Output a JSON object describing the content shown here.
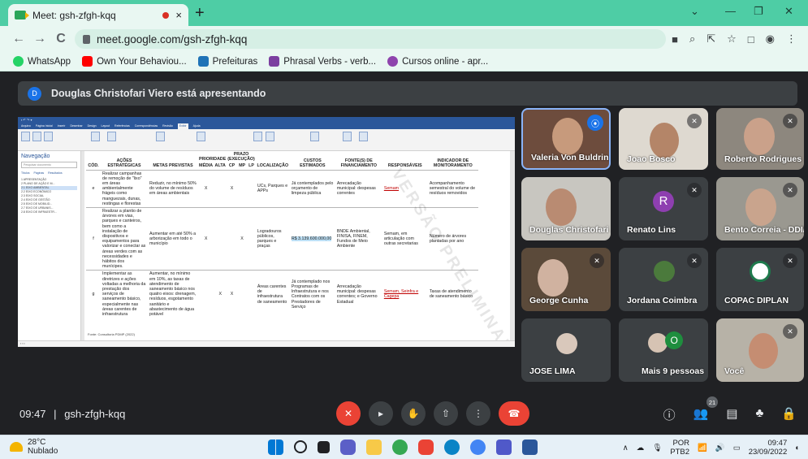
{
  "browser": {
    "tab_title": "Meet: gsh-zfgh-kqq",
    "tab_close": "×",
    "new_tab": "+",
    "url": "meet.google.com/gsh-zfgh-kqq",
    "window_controls": {
      "collapse": "⌄",
      "minimize": "—",
      "restore": "❐",
      "close": "✕"
    },
    "nav": {
      "back": "←",
      "forward": "→",
      "reload": "C"
    },
    "bookmarks": [
      {
        "label": "WhatsApp",
        "icon": "whatsapp-icon",
        "color": "#25d366"
      },
      {
        "label": "Own Your Behaviou...",
        "icon": "youtube-icon",
        "color": "#ff0000"
      },
      {
        "label": "Prefeituras",
        "icon": "prefeituras-icon",
        "color": "#1f73b7"
      },
      {
        "label": "Phrasal Verbs - verb...",
        "icon": "tm-icon",
        "color": "#7b3fa0"
      },
      {
        "label": "Cursos online - apr...",
        "icon": "cursos-icon",
        "color": "#8e44ad"
      }
    ]
  },
  "meet": {
    "presenter_initial": "D",
    "presenter_text": "Douglas Christofari Viero está apresentando",
    "meeting_time": "09:47",
    "meeting_code": "gsh-zfgh-kqq",
    "participant_count": "21",
    "tiles": [
      {
        "name": "Valeria Von Buldring",
        "icon": "speaking-icon"
      },
      {
        "name": "Joao Bosco",
        "icon": "mic-off-icon"
      },
      {
        "name": "Roberto Rodrigues",
        "icon": "mic-off-icon"
      },
      {
        "name": "Douglas Christofari ...",
        "icon": "none"
      },
      {
        "name": "Renato Lins",
        "initial": "R",
        "icon": "mic-off-icon"
      },
      {
        "name": "Bento Correia - DDI/...",
        "icon": "mic-off-icon"
      },
      {
        "name": "George Cunha",
        "icon": "mic-off-icon"
      },
      {
        "name": "Jordana Coimbra",
        "icon": "mic-off-icon"
      },
      {
        "name": "COPAC DIPLAN",
        "icon": "mic-off-icon"
      },
      {
        "name": "JOSE LIMA",
        "icon": "none"
      },
      {
        "name": "Mais 9 pessoas",
        "initial": "O",
        "icon": "none"
      },
      {
        "name": "Você",
        "icon": "mic-off-icon"
      }
    ]
  },
  "document": {
    "nav_title": "Navegação",
    "search_placeholder": "Pesquisar documento",
    "nav_tabs": [
      "Títulos",
      "Páginas",
      "Resultados"
    ],
    "nav_items": [
      "1 APRESENTAÇÃO",
      "2 PLANO DE AÇÃO E M...",
      "2.1 EIXO AMBIENTAL",
      "2.2 EIXO ECONÔMICO",
      "2.3 EIXO SOCIAL",
      "2.4 EIXO DE GESTÃO",
      "2.5 EIXO DE MOBILID...",
      "2.7 EIXO DE URBANIS...",
      "2.8 EIXO DE INFRAESTR..."
    ],
    "headers": [
      "CÓD.",
      "AÇÕES ESTRATÉGICAS",
      "METAS PREVISTAS",
      "PRIORIDADE",
      "MÉDIA",
      "ALTA",
      "PRAZO (EXECUÇÃO)",
      "CP",
      "MP",
      "LP",
      "LOCALIZAÇÃO",
      "CUSTOS ESTIMADOS",
      "FONTE(S) DE FINANCIAMENTO",
      "RESPONSÁVEIS",
      "INDICADOR DE MONITORAMENTO"
    ],
    "rows": [
      {
        "cod": "e",
        "acao": "Realizar campanhas de remoção de \"lixo\" em áreas ambientalmente frágeis como manguezais, dunas, restingas e florestas",
        "meta": "Reduzir, no mínimo 50% do volume de resíduos em áreas ambientais",
        "media": "X",
        "alta": "",
        "cp": "X",
        "mp": "",
        "lp": "",
        "local": "UCs, Parques e APPs",
        "custo": "Já contemplados pelo orçamento de limpeza pública",
        "fonte": "Arrecadação municipal: despesas correntes",
        "resp": "Semam",
        "indicador": "Acompanhamento semestral do volume de resíduos removidos"
      },
      {
        "cod": "f",
        "acao": "Realizar a plantio de árvores em vias, parques e canteiros, bem como a instalação de dispositivos e equipamentos para valorizar e conectar as áreas verdes com as necessidades e hábitos dos munícipes.",
        "meta": "Aumentar em até 50% a arborização em todo o município",
        "media": "X",
        "alta": "",
        "cp": "",
        "mp": "X",
        "lp": "",
        "local": "Logradouros públicos, parques e praças",
        "custo": "R$ 3.139.600.000,00",
        "fonte": "BNDE Ambiental, FINISA, FINEM, Fundos de Meio Ambiente",
        "resp": "Semam, em articulação com outras secretarias",
        "indicador": "Número de árvores plantadas por ano"
      },
      {
        "cod": "g",
        "acao": "Implementar as diretrizes e ações voltadas a melhoria da prestação dos serviços de saneamento básico, especialmente nas áreas carentes de infraestrutura",
        "meta": "Aumentar, no mínimo em 10%, as taxas de atendimento de saneamento básico nos quatro eixos: drenagem, resíduos, esgotamento sanitário e abastecimento de água potável",
        "media": "",
        "alta": "X",
        "cp": "X",
        "mp": "",
        "lp": "",
        "local": "Áreas carentes de infraestrutura de saneamento",
        "custo": "Já contemplado nos Programas de Infraestrutura e nos Contratos com os Prestadores de Serviço",
        "fonte": "Arrecadação municipal: despesas correntes; e Governo Estadual",
        "resp": "Semam, Seinfra e Cagepa",
        "indicador": "Taxas de atendimento de saneamento básico"
      }
    ],
    "footnote": "Fonte: Consultoria PDMP (2022)",
    "watermark": "VERSÃO PRELIMINAR"
  },
  "taskbar": {
    "temp": "28°C",
    "weather": "Nublado",
    "lang": "POR",
    "layout": "PTB2",
    "time": "09:47",
    "date": "23/09/2022"
  }
}
